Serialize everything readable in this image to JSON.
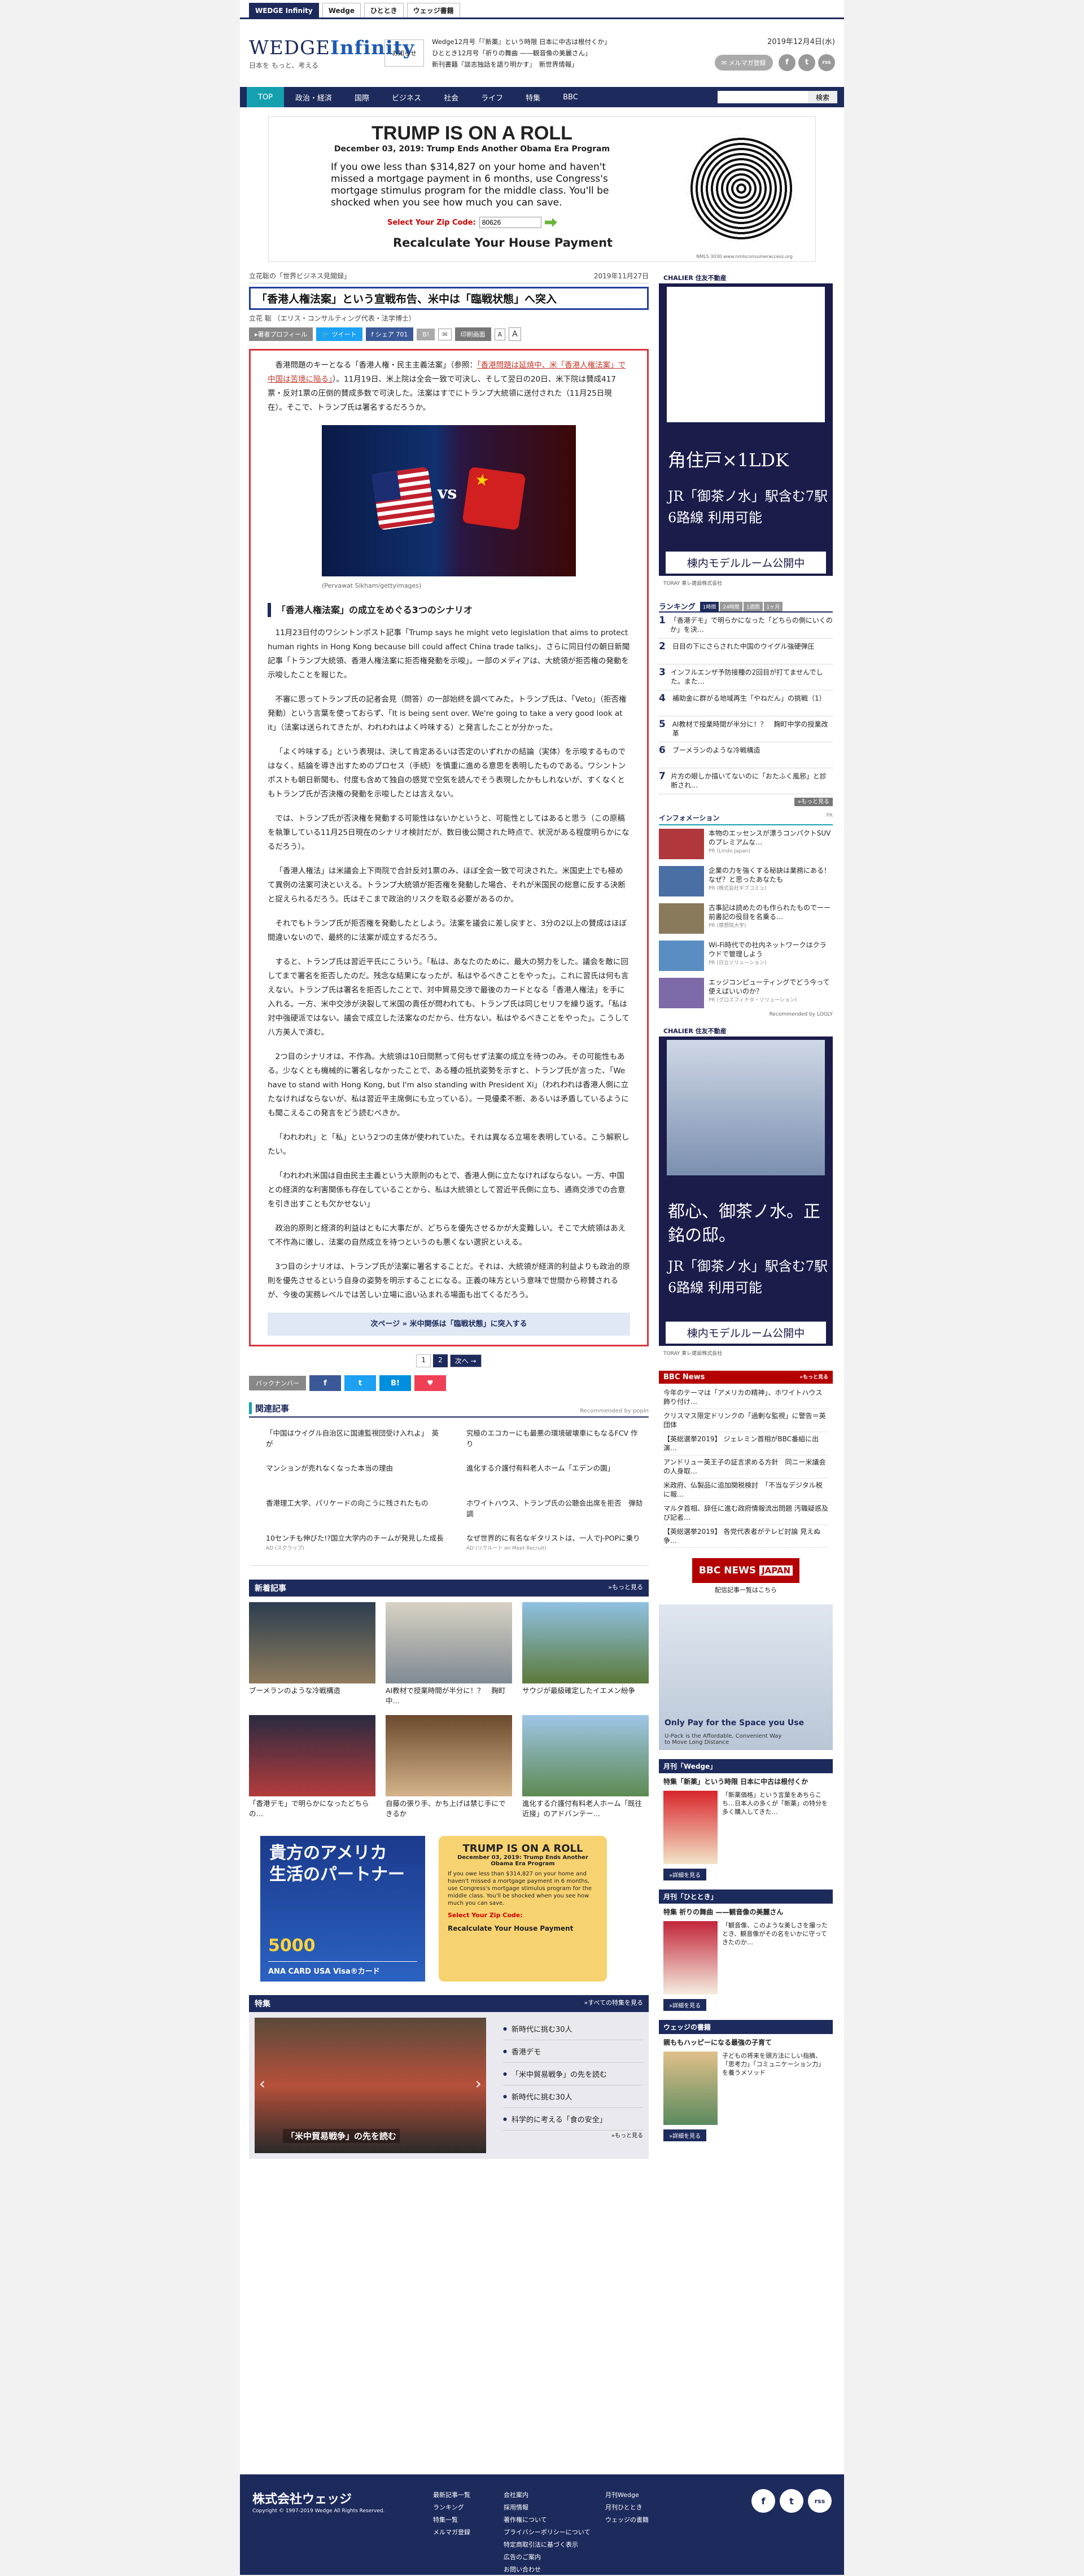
{
  "top_tabs": [
    "WEDGE Infinity",
    "Wedge",
    "ひととき",
    "ウェッジ書籍"
  ],
  "logo": {
    "name": "WEDGE",
    "name2": "Infinity",
    "tagline": "日本を もっと、考える"
  },
  "notice_label": "お知らせ",
  "header_news": [
    "Wedge12月号「『新薬』という時限 日本に中古は根付くか」",
    "ひととき12月号「祈りの舞曲 ——観音像の美麗さん」",
    "新刊書籍『談志独話を語り明かす』　新世界情報」"
  ],
  "date": "2019年12月4日(水)",
  "mail_btn": "✉ メルマガ登録",
  "sns": [
    "f",
    "t",
    "rss"
  ],
  "nav": [
    "TOP",
    "政治・経済",
    "国際",
    "ビジネス",
    "社会",
    "ライフ",
    "特集",
    "BBC"
  ],
  "search_btn": "検索",
  "top_ad": {
    "headline": "TRUMP IS ON A ROLL",
    "sub": "December 03, 2019: Trump Ends Another Obama Era Program",
    "body": "If you owe less than $314,827 on your home and haven't missed a mortgage payment in 6 months, use Congress's mortgage stimulus program for the middle class. You'll be shocked when you see how much you can save.",
    "zip_label": "Select Your Zip Code:",
    "zip_value": "80626",
    "recalc": "Recalculate Your House Payment",
    "note": "NMLS 3030  www.nmlsconsumeraccess.org"
  },
  "article": {
    "series": "立花聡の「世界ビジネス見聞録」",
    "date": "2019年11月27日",
    "title": "「香港人権法案」という宣戦布告、米中は「臨戦状態」へ突入",
    "author": "立花 聡 （エリス・コンサルティング代表・法学博士）",
    "share": [
      "▸著者プロフィール",
      "🐦 ツイート",
      "f シェア 701",
      "B!",
      "✉",
      "印刷画面",
      "A",
      "A"
    ],
    "p1_a": "香港問題のキーとなる「香港人権・民主主義法案」（参照：",
    "p1_link": "「香港問題は延焼中、米「香港人権法案」で中国は苦境に陥る」",
    "p1_b": "）。11月19日、米上院は全会一致で可決し、そして翌日の20日、米下院は賛成417票・反対1票の圧倒的賛成多数で可決した。法案はすでにトランプ大統領に送付された（11月25日現在）。そこで、トランプ氏は署名するだろうか。",
    "photo_caption": "(Pervawat Sikham/gettyimages)",
    "photo_vs": "vs",
    "h2": "「香港人権法案」の成立をめぐる3つのシナリオ",
    "paragraphs": [
      "11月23日付のワシントンポスト記事「Trump says he might veto legislation that aims to protect human rights in Hong Kong because bill could affect China trade talks」、さらに同日付の朝日新聞記事「トランプ大統領、香港人権法案に拒否権発動を示唆」。一部のメディアは、大統領が拒否権の発動を示唆したことを報じた。",
      "不審に思ってトランプ氏の記者会見（問答）の一部始終を調べてみた。トランプ氏は、「Veto」（拒否権発動）という言葉を使っておらず、「It is being sent over. We're going to take a very good look at it」（法案は送られてきたが、われわれはよく吟味する）と発言したことが分かった。",
      "「よく吟味する」という表現は、決して肯定あるいは否定のいずれかの結論（実体）を示唆するものではなく、結論を導き出すためのプロセス（手続）を慎重に進める意思を表明したものである。ワシントンポストも朝日新聞も、付度も含めて独自の感覚で空気を読んでそう表現したかもしれないが、すくなくともトランプ氏が否決権の発動を示唆したとは言えない。",
      "では、トランプ氏が否決権を発動する可能性はないかというと、可能性としてはあると思う（この原稿を執筆している11月25日現在のシナリオ検討だが、数日後公開された時点で、状況がある程度明らかになるだろう）。",
      "「香港人権法」は米議会上下両院で合計反対1票のみ、ほぼ全会一致で可決された。米国史上でも極めて異例の法案可決といえる。トランプ大統領が拒否権を発動した場合、それが米国民の総意に反する決断と捉えられるだろう。氏はそこまで政治的リスクを取る必要があるのか。",
      "それでもトランプ氏が拒否権を発動したとしよう。法案を議会に差し戻すと、3分の2以上の賛成はほぼ間違いないので、最終的に法案が成立するだろう。",
      "すると、トランプ氏は習近平氏にこういう。「私は、あなたのために、最大の努力をした。議会を敵に回してまで署名を拒否したのだ。残念な結果になったが、私はやるべきことをやった」。これに習氏は何も言えない。トランプ氏は署名を拒否したことで、対中貿易交渉で最後のカードとなる「香港人権法」を手に入れる。一方、米中交渉が決裂して米国の責任が問われても、トランプ氏は同じセリフを繰り返す。「私は対中強硬派ではない。議会で成立した法案なのだから、仕方ない。私はやるべきことをやった」。こうして八方美人で済む。",
      "2つ目のシナリオは、不作為。大統領は10日間黙って何もせず法案の成立を待つのみ。その可能性もある。少なくとも機械的に署名しなかったことで、ある種の抵抗姿勢を示すと、トランプ氏が言った、「We have to stand with Hong Kong, but I'm also standing with President Xi」（われわれは香港人側に立たなければならないが、私は習近平主席側にも立っている）。一見優柔不断、あるいは矛盾しているようにも聞こえるこの発言をどう読むべきか。",
      "「われわれ」と「私」という2つの主体が使われていた。それは異なる立場を表明している。こう解釈したい。",
      "「われわれ米国は自由民主主義という大原則のもとで、香港人側に立たなければならない。一方、中国との経済的な利害関係も存在していることから、私は大統領として習近平氏側に立ち、通商交渉での合意を引き出すことも欠かせない」",
      "政治的原則と経済的利益はともに大事だが、どちらを優先させるかが大変難しい。そこで大統領はあえて不作為に徹し、法案の自然成立を待つというのも悪くない選択といえる。",
      "3つ目のシナリオは、トランプ氏が法案に署名することだ。それは、大統領が経済的利益よりも政治的原則を優先させるという自身の姿勢を明示することになる。正義の味方という意味で世間から称賛されるが、今後の実務レベルでは苦しい立場に追い込まれる場面も出てくるだろう。"
    ],
    "next": "次ページ » 米中関係は「臨戦状態」に突入する",
    "pager": [
      "1",
      "2",
      "次へ →"
    ],
    "backnumber": "バックナンバー",
    "bottom_share": [
      "f",
      "t",
      "B!",
      "♥"
    ]
  },
  "related": {
    "title": "関連記事",
    "powered": "Recommended by popIn",
    "items": [
      {
        "text": "「中国はウイグル自治区に国連監視団受け入れよ」　英が",
        "pr": ""
      },
      {
        "text": "究極のエコカーにも最悪の環境破壊車にもなるFCV 作り",
        "pr": ""
      },
      {
        "text": "マンションが売れなくなった本当の理由",
        "pr": ""
      },
      {
        "text": "進化する介護付有料老人ホーム「エデンの園」",
        "pr": ""
      },
      {
        "text": "香港理工大学、パリケードの向こうに残されたもの",
        "pr": ""
      },
      {
        "text": "ホワイトハウス、トランプ氏の公聴会出席を拒否　弾劾調",
        "pr": ""
      },
      {
        "text": "10センチも伸びた!?国立大学内のチームが発見した成長",
        "pr": "AD (スクラップ)"
      },
      {
        "text": "なぜ世界的に有名なギタリストは、一人でJ-POPに乗り",
        "pr": "AD (リクルート on Meet Recruit)"
      }
    ]
  },
  "new_articles": {
    "title": "新着記事",
    "more": "»もっと見る",
    "items": [
      "ブーメランのような冷戦構造",
      "AI教材で授業時間が半分に！？　麹町中…",
      "サウジが最級確定したイエメン紛争",
      "「香港デモ」で明らかになったどちらの…",
      "自藤の張り手、かち上げは禁じ手にできるか",
      "進化する介護付有料老人ホーム「既往近接」のアドバンテー…"
    ]
  },
  "ana_ad": {
    "line1": "貴方のアメリカ",
    "line2": "生活のパートナー",
    "points": "5000",
    "bottom": "ANA CARD USA Visa®カード"
  },
  "small_ad": {
    "headline": "TRUMP IS ON A ROLL",
    "sub": "December 03, 2019: Trump Ends Another Obama Era Program",
    "body": "If you owe less than $314,827 on your home and haven't missed a mortgage payment in 6 months, use Congress's mortgage stimulus program for the middle class. You'll be shocked when you see how much you can save.",
    "zip": "Select Your Zip Code:",
    "recalc": "Recalculate Your House Payment"
  },
  "feature": {
    "title": "特集",
    "more": "»すべての特集を見る",
    "slide_caption": "「米中貿易戦争」の先を読む",
    "items": [
      "新時代に挑む30人",
      "香港デモ",
      "「米中貿易戦争」の先を読む",
      "新時代に挑む30人",
      "科学的に考える「食の安全」"
    ],
    "list_more": "»もっと見る"
  },
  "side_ad1": {
    "brand": "CHALIER 住友不動産",
    "t1": "角住戸×1LDK",
    "t2": "JR「御茶ノ水」駅含む7駅6路線 利用可能",
    "t3": "棟内モデルルーム公開中",
    "foot": "TORAY 東レ建設株式会社"
  },
  "ranking": {
    "title": "ランキング",
    "tabs": [
      "1時間",
      "24時間",
      "1週間",
      "1ヶ月"
    ],
    "items": [
      "「香港デモ」で明らかになった「どちらの側にいくのか」を決…",
      "日目の下にさらされた中国のウイグル強硬弾圧",
      "インフルエンザ予防接種の2回目が打てませんでした。また…",
      "補助金に群がる地域再生「やねだん」の挑戦（1）",
      "AI教材で授業時間が半分に！？　麹町中学の授業改革",
      "ブーメランのような冷戦構造",
      "片方の眼しか描いてないのに「おたふく風邪」と診断され…"
    ],
    "more": "»もっと見る"
  },
  "information": {
    "title": "インフォメーション",
    "pr": "PR",
    "items": [
      {
        "text": "本物のエッセンスが漂うコンパクトSUVのプレミアムな…",
        "pr": "PR (Lindo Japan)"
      },
      {
        "text": "企業の力を強くする秘訣は業務にある！なぜ？と思ったあなたも",
        "pr": "PR (株式会社ギブコミュ)"
      },
      {
        "text": "古事記は読めたのも作られたものでーー前書記の役目を名乗る…",
        "pr": "PR (感想院大学)"
      },
      {
        "text": "Wi-Fi時代での社内ネットワークはクラウドで管理しよう",
        "pr": "PR (日立ソリューション)"
      },
      {
        "text": "エッジコンピューティングでどう今って使えばいいのか？",
        "pr": "PR (グロスフィナタ・ソリューション)"
      }
    ],
    "reco": "Recommended by  LOGLY"
  },
  "side_ad2": {
    "brand": "CHALIER 住友不動産",
    "t1": "都心、御茶ノ水。正銘の邸。",
    "t2": "JR「御茶ノ水」駅含む7駅6路線 利用可能",
    "t3": "棟内モデルルーム公開中",
    "foot": "TORAY 東レ建設株式会社"
  },
  "bbc": {
    "title": "BBC News",
    "more": "»もっと見る",
    "items": [
      "今年のテーマは「アメリカの精神」、ホワイトハウス飾り付け…",
      "クリスマス限定ドリンクの「過剰な監視」に警告＝英団体",
      "【英総選挙2019】 ジェレミン首相がBBC番組に出演…",
      "アンドリュー英王子の証言求める方針　同ニー米議会の人身取…",
      "米政府、仏製品に追加関税検討　「不当なデジタル税に報…",
      "マルタ首相、辞任に進む政府情報流出問題 汚職疑惑及び記者…",
      "【英総選挙2019】 各党代表者がテレビ討論 見えぬ争…"
    ],
    "logo": "BBC NEWS",
    "logo_sub": "JAPAN",
    "note": "配信記事一覧はこちら"
  },
  "upack": {
    "title": "Only Pay for the Space you Use",
    "sub": "U-Pack is the Affordable, Convenient Way to Move Long Distance"
  },
  "magazines": [
    {
      "head": "月刊「Wedge」",
      "title": "特集「新薬」という時限 日本に中古は根付くか",
      "text": "「新薬価格」という言葉をあちらこち…日本人の多くが「新薬」の特分を多く購入してきた…"
    },
    {
      "head": "月刊「ひととき」",
      "title": "特集 祈りの舞曲 ——観音像の美麗さん",
      "text": "「観音像、このような美しさを撮ったとき、観音像がその名をいかに守ってきたのか…"
    },
    {
      "head": "ウェッジの書籍",
      "title": "親ももハッピーになる最強の子育て",
      "text": "子どもの将来を頭方法にしい指摘、「思考力」「コミュニケーション力」を養うメソッド"
    }
  ],
  "detail_btn": "»詳細を見る",
  "footer": {
    "company": "株式会社ウェッジ",
    "copyright": "Copyright © 1997-2019 Wedge All Rights Reserved.",
    "col1": [
      "最新記事一覧",
      "ランキング",
      "特集一覧",
      "メルマガ登録"
    ],
    "col2": [
      "会社案内",
      "採用情報",
      "著作権について",
      "プライバシーポリシーについて",
      "特定商取引法に基づく表示",
      "広告のご案内",
      "お問い合わせ"
    ],
    "col3": [
      "月刊Wedge",
      "月刊ひととき",
      "ウェッジの書籍"
    ]
  },
  "colors": {
    "navy": "#1d2a5c",
    "accent": "#15a0b0",
    "title_border": "#233e9e",
    "article_border": "#d9353f"
  }
}
